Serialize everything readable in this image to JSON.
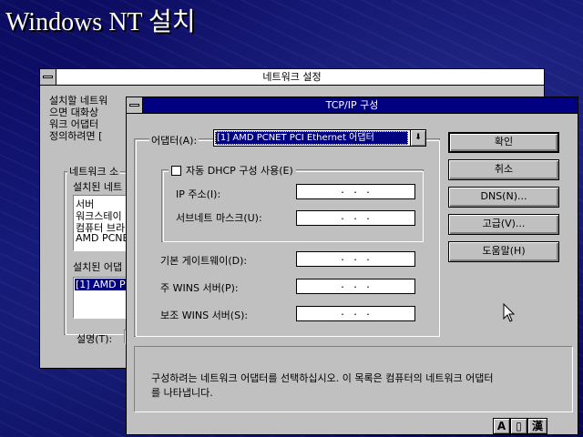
{
  "desktop": {
    "title": "Windows NT 설치"
  },
  "network_window": {
    "title": "네트워크 설정",
    "intro_lines": [
      "설치할 네트워",
      "으면 대화상",
      "워크 어댑터",
      "정의하려면 ["
    ],
    "group_label": "네트워크 소",
    "installed_software_label": "설치된 네트",
    "software_items": [
      "서버",
      "워크스테이",
      "컴퓨터 브라",
      "AMD PCNE"
    ],
    "installed_adapter_label": "설치된 어댑",
    "adapter_items": [
      "[1] AMD PC"
    ],
    "description_label": "설명(T):"
  },
  "tcpip_dialog": {
    "title": "TCP/IP 구성",
    "adapter_label": "어댑터(A):",
    "adapter_value": "[1] AMD PCNET PCI Ethernet 어댑터",
    "dhcp_label": "자동 DHCP 구성 사용(E)",
    "dhcp_checked": false,
    "ip_label": "IP 주소(I):",
    "subnet_label": "서브네트 마스크(U):",
    "gateway_label": "기본 게이트웨이(D):",
    "primary_wins_label": "주 WINS 서버(P):",
    "secondary_wins_label": "보조 WINS 서버(S):",
    "empty_address": ".    .    .",
    "buttons": {
      "ok": "확인",
      "cancel": "취소",
      "dns": "DNS(N)...",
      "advanced": "고급(V)...",
      "help": "도움말(H)"
    },
    "status_text_line1": "구성하려는 네트워크 어댑터를 선택하십시오. 이 목록은 컴퓨터의 네트워크 어댑터",
    "status_text_line2": "를 나타냅니다."
  },
  "ime_bar": {
    "mode_a": "A",
    "mode_full": "▯",
    "mode_hanja": "漢"
  },
  "colors": {
    "active_title": "#000080",
    "face": "#c0c0c0",
    "desktop": "#0a0a4e"
  }
}
